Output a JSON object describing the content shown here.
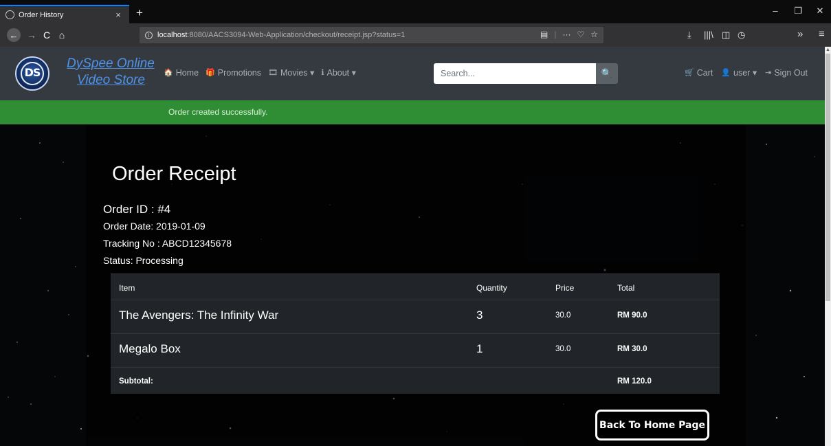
{
  "browser": {
    "tab_title": "Order History",
    "tab_close": "×",
    "new_tab": "+",
    "win_minimize": "–",
    "win_restore": "❐",
    "win_close": "✕",
    "back": "←",
    "forward": "→",
    "reload": "C",
    "home": "⌂",
    "url_host": "localhost",
    "url_rest": ":8080/AACS3094-Web-Application/checkout/receipt.jsp?status=1",
    "reader_icon": "▤",
    "more_icon": "···",
    "pocket_icon": "♡",
    "bookmark_icon": "☆",
    "download_icon": "⤓",
    "library_icon": "|||\\",
    "sidebar_icon": "◫",
    "history_icon": "◷",
    "overflow_icon": "»",
    "menu_icon": "≡"
  },
  "navbar": {
    "brand_line1": "DySpee Online",
    "brand_line2": "Video Store",
    "logo_text": "DS",
    "links": [
      {
        "icon": "🏠",
        "label": "Home"
      },
      {
        "icon": "🎁",
        "label": "Promotions"
      },
      {
        "icon": "🎞",
        "label": "Movies ▾"
      },
      {
        "icon": "ℹ",
        "label": "About ▾"
      }
    ],
    "search_placeholder": "Search...",
    "search_icon": "🔍",
    "cart_icon": "🛒",
    "cart_label": "Cart",
    "user_icon": "👤",
    "user_label": "user ▾",
    "signout_icon": "⇥",
    "signout_label": "Sign Out"
  },
  "alert": {
    "message": "Order created successfully."
  },
  "receipt": {
    "title": "Order Receipt",
    "order_id": "Order ID : #4",
    "order_date": "Order Date: 2019-01-09",
    "tracking": "Tracking No : ABCD12345678",
    "status": "Status: Processing"
  },
  "table": {
    "headers": [
      "Item",
      "Quantity",
      "Price",
      "Total"
    ],
    "rows": [
      {
        "item": "The Avengers: The Infinity War",
        "quantity": "3",
        "price": "30.0",
        "total": "RM 90.0"
      },
      {
        "item": "Megalo Box",
        "quantity": "1",
        "price": "30.0",
        "total": "RM 30.0"
      }
    ],
    "subtotal_label": "Subtotal:",
    "subtotal_value": "RM 120.0"
  },
  "actions": {
    "back_home": "Back To Home Page"
  },
  "colors": {
    "navbar_bg": "#343a40",
    "alert_bg": "#2f8d33",
    "brand": "#4f93e8",
    "table_bg": "#212529"
  }
}
